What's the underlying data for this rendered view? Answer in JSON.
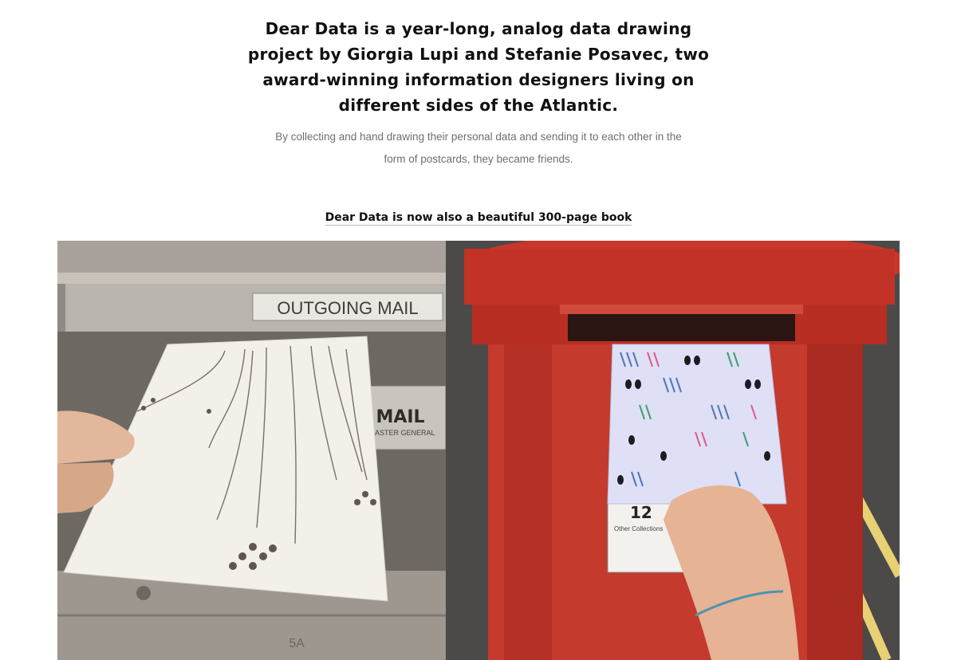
{
  "intro": {
    "headline": "Dear Data is a year-long, analog data drawing project by Giorgia Lupi and Stefanie Posavec, two award-winning information designers living on different sides of the Atlantic.",
    "body": "By collecting and hand drawing their personal data and sending it to each other in the form of postcards, they became friends."
  },
  "book": {
    "link_label": "Dear Data is now also a beautiful 300-page book"
  },
  "photos": {
    "left": {
      "sign_text": "OUTGOING MAIL",
      "slot_text": "MAIL",
      "slot_subtext": "MASTER GENERAL",
      "box_number": "5A"
    },
    "right": {
      "plate_number": "12",
      "plate_caption": "Other Collections"
    }
  }
}
